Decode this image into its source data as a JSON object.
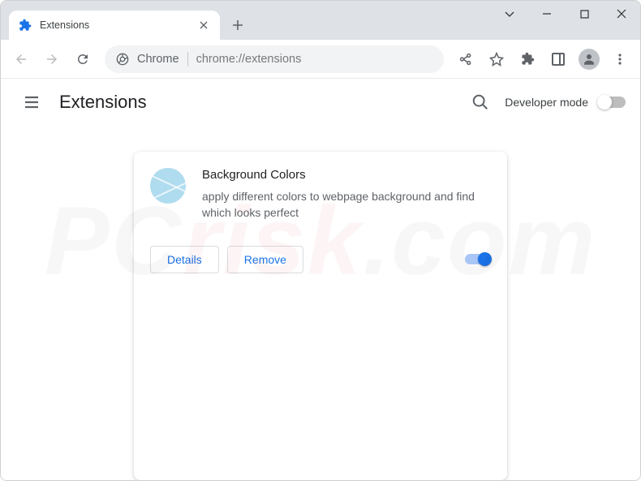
{
  "titlebar": {
    "tab_title": "Extensions"
  },
  "toolbar": {
    "omnibox_prefix": "Chrome",
    "url": "chrome://extensions"
  },
  "header": {
    "title": "Extensions",
    "dev_mode_label": "Developer mode"
  },
  "extension": {
    "name": "Background Colors",
    "description": "apply different colors to webpage background and find which looks perfect",
    "details_label": "Details",
    "remove_label": "Remove"
  }
}
